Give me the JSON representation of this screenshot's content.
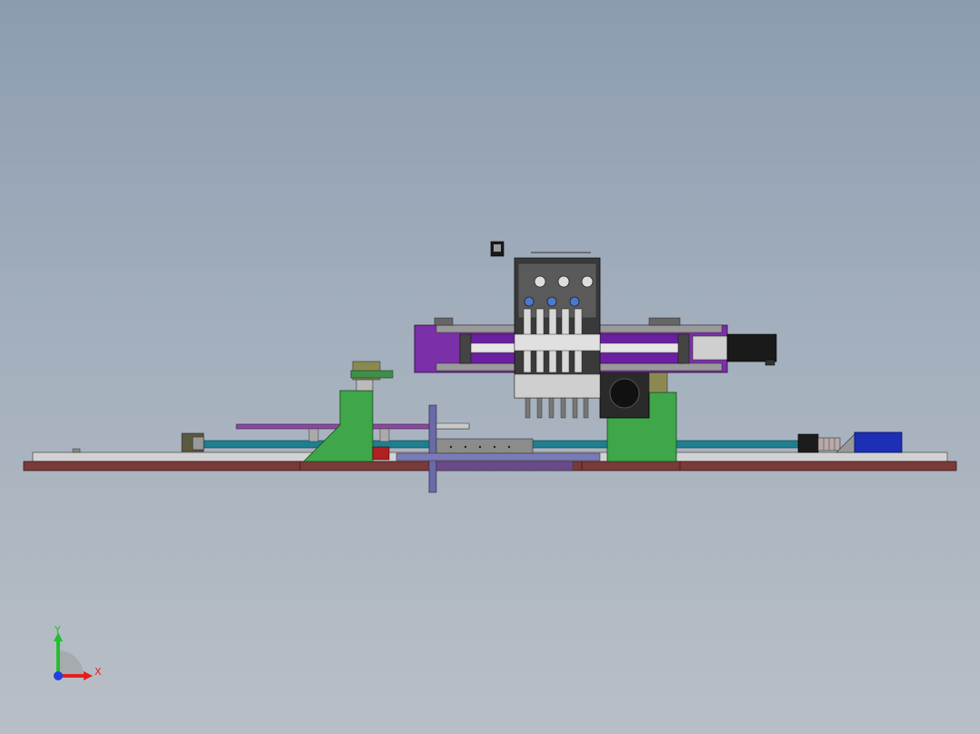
{
  "colors": {
    "background_top": "#8c9cb0",
    "background_bottom": "#b9bfc6",
    "base_plate": "#7a3a3a",
    "rail_top": "#c8c8c8",
    "green_bracket": "#3fa64a",
    "purple_module": "#7b2fa8",
    "teal_shaft": "#1f7f8f",
    "blue_box": "#1c2fb5",
    "dark_frame": "#2a2a2a",
    "axis_x": "#e02020",
    "axis_y": "#20c030",
    "axis_z": "#2040e0"
  },
  "axis_triad": {
    "x_label": "X",
    "y_label": "Y",
    "icon": "coordinate-triad-icon"
  }
}
